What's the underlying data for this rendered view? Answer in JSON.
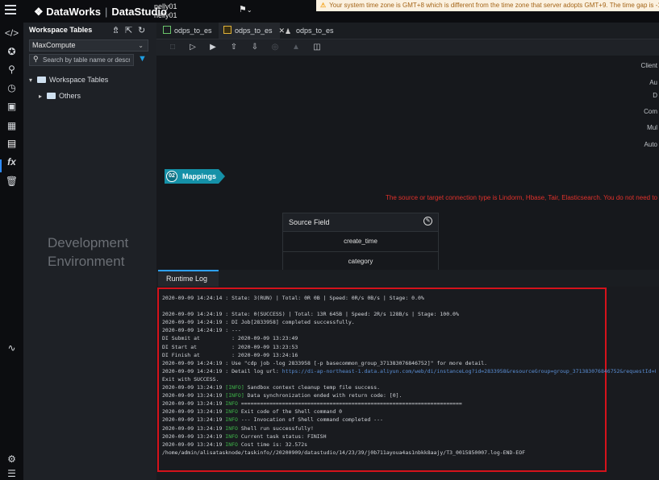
{
  "topbar": {
    "brand": "DataWorks",
    "product": "DataStudio",
    "user_line1": "nelly01",
    "user_line2": "nelly01",
    "timezone_warning": "Your system time zone is GMT+8 which is different from the time zone that server adopts GMT+9. The time gap is -1"
  },
  "rail": {
    "icons": [
      "code-icon",
      "puzzle-icon",
      "search-icon",
      "clock-icon",
      "briefcase-icon",
      "table-icon",
      "workspace-tables-icon",
      "function-icon",
      "trash-icon",
      "lineage-icon",
      "settings-icon",
      "menu-icon"
    ],
    "active": "workspace-tables-icon"
  },
  "workspace": {
    "title": "Workspace Tables",
    "engine": "MaxCompute",
    "search_placeholder": "Search by table name or descrip",
    "tree": {
      "root": "Workspace Tables",
      "child": "Others"
    },
    "environment_line1": "Development",
    "environment_line2": "Environment"
  },
  "tabs": [
    {
      "label": "odps_to_es",
      "icon": "table-icon",
      "active": false
    },
    {
      "label": "odps_to_es",
      "icon": "di-node-icon",
      "active": true
    },
    {
      "label": "odps_to_es",
      "icon": "user-node-icon",
      "active": false
    }
  ],
  "toolbar": {
    "icons": [
      "save-icon",
      "run-icon",
      "run-with-params-icon",
      "submit-icon",
      "deploy-icon",
      "stop-icon",
      "lock-icon",
      "script-mode-icon"
    ]
  },
  "canvas": {
    "side_labels": [
      "Client",
      "Au",
      "D",
      "Com",
      "Mul",
      "Auto"
    ],
    "mapping_step_number": "02",
    "mapping_step_label": "Mappings",
    "warning": "The source or target connection type is Lindorm, Hbase, Tair, Elasticsearch. You do not need to",
    "source_field_header": "Source Field",
    "source_fields": [
      "create_time",
      "category"
    ]
  },
  "log": {
    "tab_label": "Runtime Log",
    "lines": [
      {
        "text": "2020-09-09 14:24:14 : State: 3(RUN) | Total: 0R 0B | Speed: 0R/s 0B/s | Stage: 0.0%"
      },
      {
        "text": ""
      },
      {
        "text": "2020-09-09 14:24:19 : State: 0(SUCCESS) | Total: 13R 645B | Speed: 2R/s 128B/s | Stage: 100.0%"
      },
      {
        "text": "2020-09-09 14:24:19 : DI Job[2833958] completed successfully."
      },
      {
        "text": "2020-09-09 14:24:19 : ---"
      },
      {
        "text": "DI Submit at          : 2020-09-09 13:23:49"
      },
      {
        "text": "DI Start at           : 2020-09-09 13:23:53"
      },
      {
        "text": "DI Finish at          : 2020-09-09 13:24:16"
      },
      {
        "text": "2020-09-09 14:24:19 : Use \"cdp job -log 2833958 [-p basecommon_group_371383076846752]\" for more detail."
      },
      {
        "text": "2020-09-09 14:24:19 : Detail log url: ",
        "link": "https://di-ap-northeast-1.data.aliyun.com/web/di/instanceLog?id=2833958&resourceGroup=group_371383076846752&requestId=8bdf"
      },
      {
        "text": "Exit with SUCCESS."
      },
      {
        "text": "2020-09-09 13:24:19 ",
        "tag": "[INFO]",
        "rest": " Sandbox context cleanup temp file success."
      },
      {
        "text": "2020-09-09 13:24:19 ",
        "tag": "[INFO]",
        "rest": " Data synchronization ended with return code: [0]."
      },
      {
        "text": "2020-09-09 13:24:19 ",
        "tag": "INFO",
        "rest": " ======================================================================"
      },
      {
        "text": "2020-09-09 13:24:19 ",
        "tag": "INFO",
        "rest": " Exit code of the Shell command 0"
      },
      {
        "text": "2020-09-09 13:24:19 ",
        "tag": "INFO",
        "rest": " --- Invocation of Shell command completed ---"
      },
      {
        "text": "2020-09-09 13:24:19 ",
        "tag": "INFO",
        "rest": " Shell run successfully!"
      },
      {
        "text": "2020-09-09 13:24:19 ",
        "tag": "INFO",
        "rest": " Current task status: FINISH"
      },
      {
        "text": "2020-09-09 13:24:19 ",
        "tag": "INFO",
        "rest": " Cost time is: 32.572s"
      },
      {
        "text": "/home/admin/alisatasknode/taskinfo//20200909/datastudio/14/23/39/j0b711ayoua4as1nbkk8aajy/T3_0015850007.log-END-EOF"
      }
    ]
  },
  "colors": {
    "accent": "#2e8bff",
    "mapping_pill": "#1591a8",
    "highlight_border": "#d5121b",
    "info_green": "#3fb84a",
    "warning_red": "#e0312b"
  }
}
